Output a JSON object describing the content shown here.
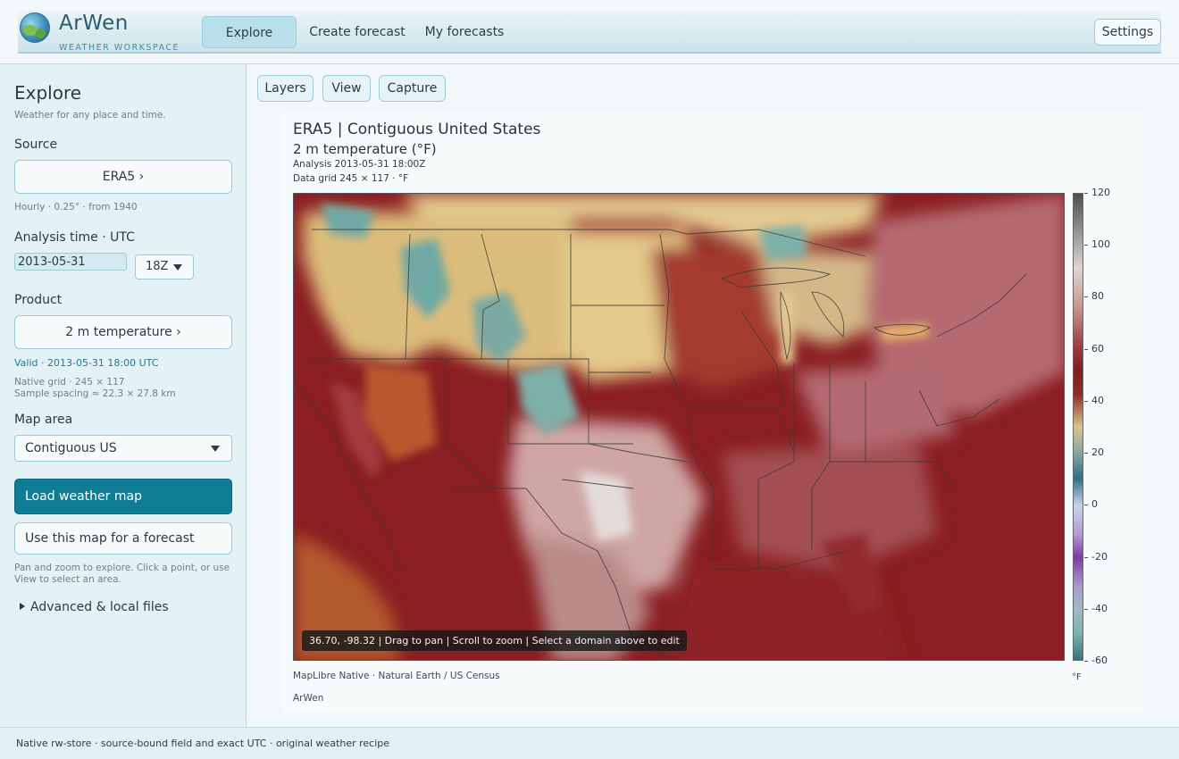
{
  "brand": {
    "name": "ArWen",
    "subtitle": "WEATHER WORKSPACE"
  },
  "nav": {
    "tabs": [
      {
        "label": "Explore",
        "active": true
      },
      {
        "label": "Create forecast"
      },
      {
        "label": "My forecasts"
      }
    ],
    "settings_label": "Settings"
  },
  "sidebar": {
    "title": "Explore",
    "subtitle": "Weather for any place and time.",
    "source_label": "Source",
    "source_value": "ERA5 ›",
    "source_note": "Hourly · 0.25° · from 1940",
    "analysis_label": "Analysis time · UTC",
    "date_value": "2013-05-31",
    "hour_value": "18Z",
    "product_label": "Product",
    "product_value": "2 m temperature ›",
    "valid_text": "Valid · 2013-05-31 18:00 UTC",
    "native_grid": "Native grid · 245 × 117",
    "sample_spacing": "Sample spacing ≈ 22.3 × 27.8 km",
    "map_area_label": "Map area",
    "map_area_value": "Contiguous US",
    "load_button": "Load weather map",
    "forecast_button": "Use this map for a forecast",
    "hint_line1": "Pan and zoom to explore. Click a point, or use",
    "hint_line2": "View to select an area.",
    "advanced_label": "Advanced & local files"
  },
  "toolbar": {
    "layers": "Layers",
    "view": "View",
    "capture": "Capture"
  },
  "map": {
    "title": "ERA5 | Contiguous United States",
    "subtitle": "2 m temperature (°F)",
    "analysis": "Analysis 2013-05-31 18:00Z",
    "data_grid": "Data grid 245 × 117 · °F",
    "hud": "36.70, -98.32  |  Drag to pan | Scroll to zoom | Select a domain above to edit",
    "attribution": "MapLibre Native ·  Natural Earth / US Census",
    "brand": "ArWen",
    "colorbar": {
      "labels": [
        "120",
        "100",
        "80",
        "60",
        "40",
        "20",
        "0",
        "-20",
        "-40",
        "-60"
      ],
      "unit": "°F"
    }
  },
  "colors": {
    "accent": "#0f7d96",
    "map_hot": "#8a1e22",
    "map_cool": "#6fa8a4",
    "map_mild": "#e2cc8c"
  },
  "footer": {
    "text": "Native rw-store · source-bound field and exact UTC · original weather recipe"
  }
}
